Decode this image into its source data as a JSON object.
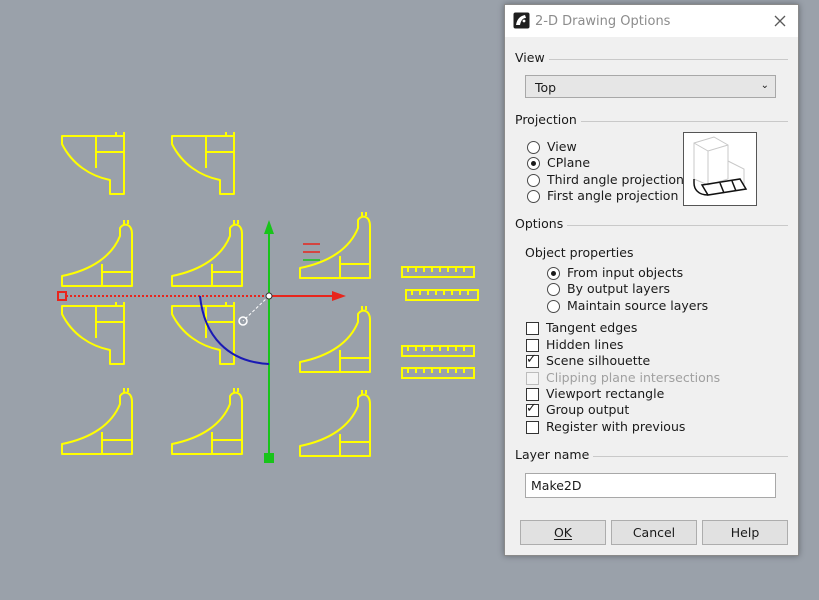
{
  "dialog": {
    "title": "2-D Drawing Options",
    "view": {
      "label": "View",
      "selected": "Top"
    },
    "projection": {
      "label": "Projection",
      "options": [
        "View",
        "CPlane",
        "Third angle projection",
        "First angle projection"
      ],
      "selected_index": 1
    },
    "options": {
      "label": "Options",
      "object_properties_label": "Object properties",
      "object_properties": [
        "From input objects",
        "By output layers",
        "Maintain source layers"
      ],
      "object_properties_selected": 0,
      "checkboxes": [
        {
          "label": "Tangent edges",
          "checked": false,
          "enabled": true
        },
        {
          "label": "Hidden lines",
          "checked": false,
          "enabled": true
        },
        {
          "label": "Scene silhouette",
          "checked": true,
          "enabled": true
        },
        {
          "label": "Clipping plane intersections",
          "checked": false,
          "enabled": false
        },
        {
          "label": "Viewport rectangle",
          "checked": false,
          "enabled": true
        },
        {
          "label": "Group output",
          "checked": true,
          "enabled": true
        },
        {
          "label": "Register with previous",
          "checked": false,
          "enabled": true
        }
      ]
    },
    "layer_name": {
      "label": "Layer name",
      "value": "Make2D"
    },
    "buttons": {
      "ok": "OK",
      "cancel": "Cancel",
      "help": "Help"
    }
  },
  "colors": {
    "viewport_background": "#9aa1aa",
    "curve_yellow": "#ffff00",
    "axis_x_red": "#e8251c",
    "axis_y_green": "#18c41a",
    "arc_blue": "#1a1ab4"
  },
  "icons": [
    "rhino-logo-icon",
    "close-icon",
    "chevron-down-icon",
    "checkmark-icon"
  ]
}
